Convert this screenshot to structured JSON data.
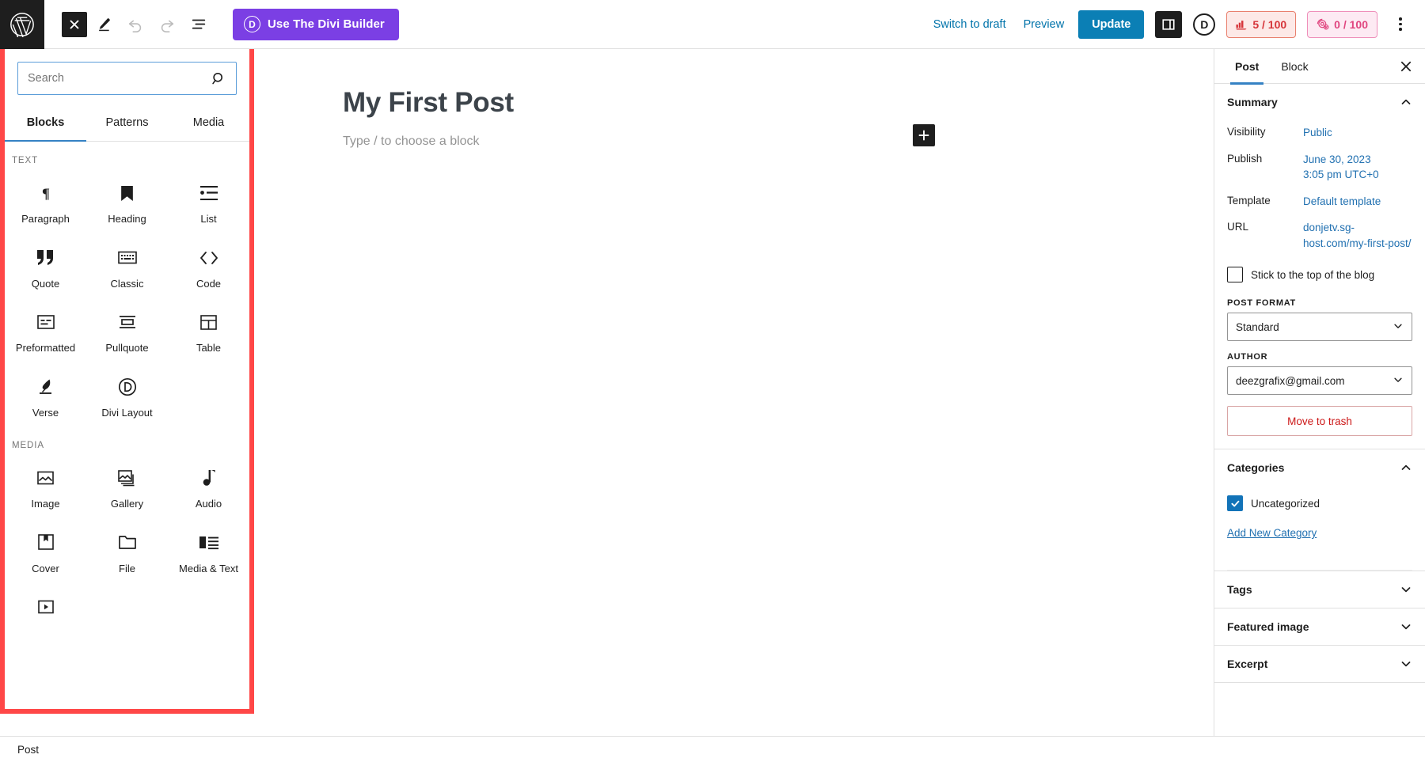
{
  "toolbar": {
    "wp_logo": "wordpress-logo",
    "close_label": "×",
    "edit_icon": "pencil-icon",
    "undo_icon": "undo-icon",
    "redo_icon": "redo-icon",
    "list_view_icon": "list-view-icon",
    "divi_builder_label": "Use The Divi Builder",
    "divi_mark": "D",
    "switch_to_draft": "Switch to draft",
    "preview": "Preview",
    "update": "Update",
    "settings_icon": "settings-sidebar-icon",
    "divi_circle": "D",
    "seo_score": "5 / 100",
    "readability_score": "0 / 100",
    "more_options_icon": "kebab-menu-icon"
  },
  "inserter": {
    "search_placeholder": "Search",
    "search_value": "",
    "search_icon": "search-icon",
    "tabs": [
      {
        "label": "Blocks",
        "active": true
      },
      {
        "label": "Patterns",
        "active": false
      },
      {
        "label": "Media",
        "active": false
      }
    ],
    "groups": [
      {
        "label": "TEXT",
        "blocks": [
          {
            "label": "Paragraph",
            "icon": "paragraph-icon"
          },
          {
            "label": "Heading",
            "icon": "heading-icon"
          },
          {
            "label": "List",
            "icon": "list-icon"
          },
          {
            "label": "Quote",
            "icon": "quote-icon"
          },
          {
            "label": "Classic",
            "icon": "classic-icon"
          },
          {
            "label": "Code",
            "icon": "code-icon"
          },
          {
            "label": "Preformatted",
            "icon": "preformatted-icon"
          },
          {
            "label": "Pullquote",
            "icon": "pullquote-icon"
          },
          {
            "label": "Table",
            "icon": "table-icon"
          },
          {
            "label": "Verse",
            "icon": "verse-icon"
          },
          {
            "label": "Divi Layout",
            "icon": "divi-layout-icon"
          }
        ]
      },
      {
        "label": "MEDIA",
        "blocks": [
          {
            "label": "Image",
            "icon": "image-icon"
          },
          {
            "label": "Gallery",
            "icon": "gallery-icon"
          },
          {
            "label": "Audio",
            "icon": "audio-icon"
          },
          {
            "label": "Cover",
            "icon": "cover-icon"
          },
          {
            "label": "File",
            "icon": "file-icon"
          },
          {
            "label": "Media & Text",
            "icon": "media-text-icon"
          },
          {
            "label": "",
            "icon": "video-icon"
          }
        ]
      }
    ]
  },
  "canvas": {
    "post_title": "My First Post",
    "body_placeholder": "Type / to choose a block",
    "add_block_icon": "plus-icon"
  },
  "sidebar": {
    "tabs": [
      {
        "label": "Post",
        "active": true
      },
      {
        "label": "Block",
        "active": false
      }
    ],
    "close_icon": "close-icon",
    "summary": {
      "title": "Summary",
      "expanded": true,
      "rows": [
        {
          "key": "Visibility",
          "value": "Public"
        },
        {
          "key": "Publish",
          "value": "June 30, 2023\n3:05 pm UTC+0"
        },
        {
          "key": "Template",
          "value": "Default template"
        },
        {
          "key": "URL",
          "value": "donjetv.sg-host.com/my-first-post/"
        }
      ],
      "sticky_label": "Stick to the top of the blog",
      "sticky_checked": false,
      "post_format_label": "POST FORMAT",
      "post_format_value": "Standard",
      "author_label": "AUTHOR",
      "author_value": "deezgrafix@gmail.com",
      "trash_label": "Move to trash"
    },
    "categories": {
      "title": "Categories",
      "expanded": true,
      "items": [
        {
          "label": "Uncategorized",
          "checked": true
        }
      ],
      "add_new_label": "Add New Category"
    },
    "collapsed_panels": [
      {
        "title": "Tags"
      },
      {
        "title": "Featured image"
      },
      {
        "title": "Excerpt"
      }
    ]
  },
  "bottom": {
    "breadcrumb": "Post"
  },
  "colors": {
    "accent_blue": "#3582c4",
    "link_blue": "#2271b1",
    "update_blue": "#0b7fb5",
    "divi_purple": "#7b3fe4",
    "highlight_red": "#ff4747",
    "seo_red": "#d6353a",
    "seo_pink": "#e0457f"
  }
}
